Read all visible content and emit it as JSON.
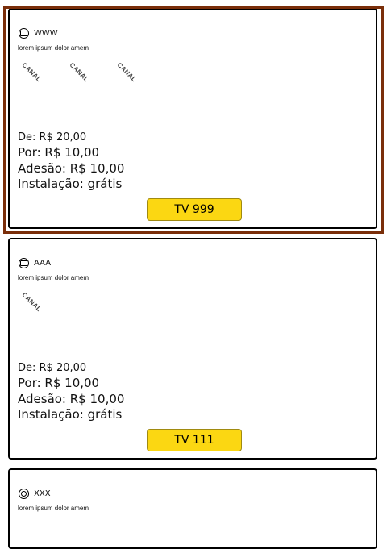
{
  "cards": [
    {
      "name": "WWW",
      "description": "lorem ipsum dolor amem",
      "channels": [
        "CANAL",
        "CANAL",
        "CANAL"
      ],
      "price_from": "De: R$ 20,00",
      "price_now": "Por: R$ 10,00",
      "adhesion": "Adesão: R$ 10,00",
      "installation": "Instalação: grátis",
      "button_label": "TV 999"
    },
    {
      "name": "AAA",
      "description": "lorem ipsum dolor amem",
      "channels": [
        "CANAL"
      ],
      "price_from": "De: R$ 20,00",
      "price_now": "Por: R$ 10,00",
      "adhesion": "Adesão: R$ 10,00",
      "installation": "Instalação: grátis",
      "button_label": "TV 111"
    },
    {
      "name": "XXX",
      "description": "lorem ipsum dolor amem"
    }
  ],
  "colors": {
    "selected_frame": "#7a2e0a",
    "button_bg": "#fbd712"
  },
  "icons": {
    "tv_icon": "tv-icon",
    "globe_icon": "globe-icon"
  }
}
